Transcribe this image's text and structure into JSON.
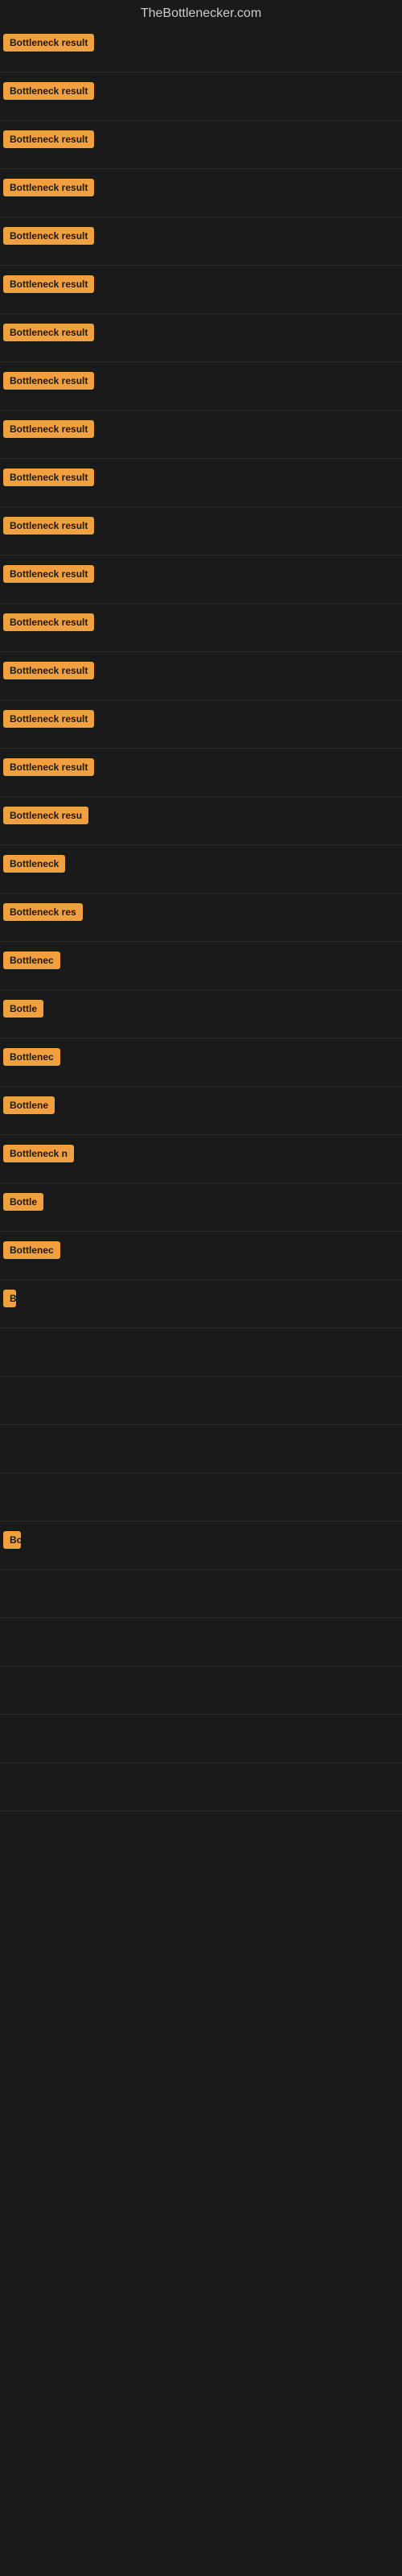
{
  "site": {
    "title": "TheBottlenecker.com"
  },
  "items": [
    {
      "id": 1,
      "label": "Bottleneck result",
      "width": 130
    },
    {
      "id": 2,
      "label": "Bottleneck result",
      "width": 130
    },
    {
      "id": 3,
      "label": "Bottleneck result",
      "width": 130
    },
    {
      "id": 4,
      "label": "Bottleneck result",
      "width": 130
    },
    {
      "id": 5,
      "label": "Bottleneck result",
      "width": 130
    },
    {
      "id": 6,
      "label": "Bottleneck result",
      "width": 130
    },
    {
      "id": 7,
      "label": "Bottleneck result",
      "width": 130
    },
    {
      "id": 8,
      "label": "Bottleneck result",
      "width": 130
    },
    {
      "id": 9,
      "label": "Bottleneck result",
      "width": 130
    },
    {
      "id": 10,
      "label": "Bottleneck result",
      "width": 130
    },
    {
      "id": 11,
      "label": "Bottleneck result",
      "width": 130
    },
    {
      "id": 12,
      "label": "Bottleneck result",
      "width": 130
    },
    {
      "id": 13,
      "label": "Bottleneck result",
      "width": 130
    },
    {
      "id": 14,
      "label": "Bottleneck result",
      "width": 130
    },
    {
      "id": 15,
      "label": "Bottleneck result",
      "width": 130
    },
    {
      "id": 16,
      "label": "Bottleneck result",
      "width": 130
    },
    {
      "id": 17,
      "label": "Bottleneck resu",
      "width": 115
    },
    {
      "id": 18,
      "label": "Bottleneck",
      "width": 85
    },
    {
      "id": 19,
      "label": "Bottleneck res",
      "width": 105
    },
    {
      "id": 20,
      "label": "Bottlenec",
      "width": 75
    },
    {
      "id": 21,
      "label": "Bottle",
      "width": 55
    },
    {
      "id": 22,
      "label": "Bottlenec",
      "width": 75
    },
    {
      "id": 23,
      "label": "Bottlene",
      "width": 68
    },
    {
      "id": 24,
      "label": "Bottleneck n",
      "width": 90
    },
    {
      "id": 25,
      "label": "Bottle",
      "width": 52
    },
    {
      "id": 26,
      "label": "Bottlenec",
      "width": 72
    },
    {
      "id": 27,
      "label": "B",
      "width": 16
    },
    {
      "id": 28,
      "label": "",
      "width": 0
    },
    {
      "id": 29,
      "label": "",
      "width": 0
    },
    {
      "id": 30,
      "label": "",
      "width": 0
    },
    {
      "id": 31,
      "label": "",
      "width": 0
    },
    {
      "id": 32,
      "label": "Bo",
      "width": 22
    },
    {
      "id": 33,
      "label": "",
      "width": 0
    },
    {
      "id": 34,
      "label": "",
      "width": 0
    },
    {
      "id": 35,
      "label": "",
      "width": 0
    },
    {
      "id": 36,
      "label": "",
      "width": 0
    },
    {
      "id": 37,
      "label": "",
      "width": 0
    }
  ]
}
